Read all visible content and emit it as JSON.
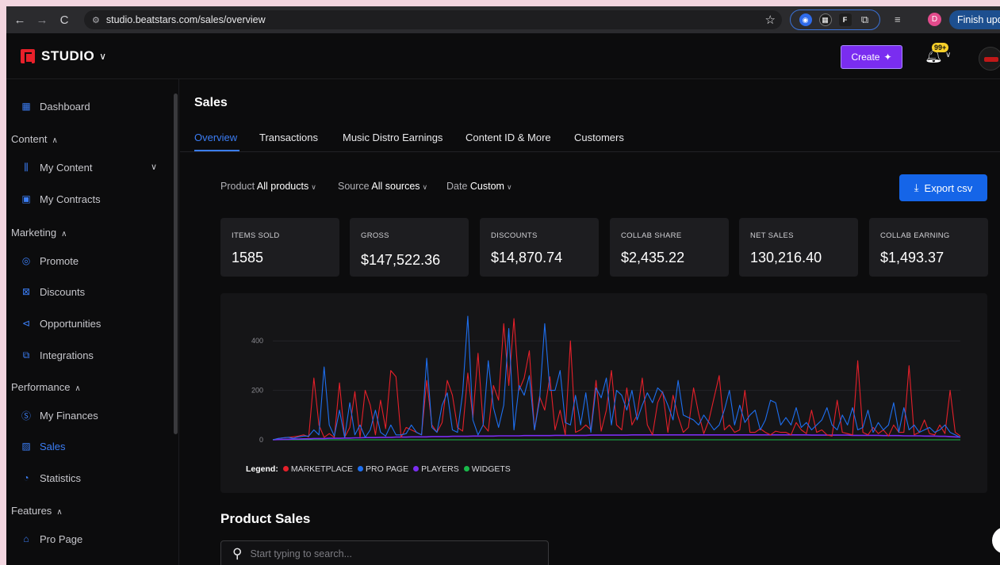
{
  "browser": {
    "url": "studio.beatstars.com/sales/overview",
    "back_icon": "←",
    "forward_icon": "→",
    "reload_icon": "C",
    "profile_initial": "D",
    "finish_label": "Finish upd"
  },
  "header": {
    "brand": "STUDIO",
    "create_label": "Create",
    "notification_badge": "99+"
  },
  "sidebar": {
    "dashboard": "Dashboard",
    "content_head": "Content",
    "my_content": "My Content",
    "my_contracts": "My Contracts",
    "marketing_head": "Marketing",
    "promote": "Promote",
    "discounts": "Discounts",
    "opportunities": "Opportunities",
    "integrations": "Integrations",
    "performance_head": "Performance",
    "my_finances": "My Finances",
    "sales": "Sales",
    "statistics": "Statistics",
    "features_head": "Features",
    "pro_page": "Pro Page",
    "content_id": "Content ID & More"
  },
  "main": {
    "title": "Sales",
    "tabs": [
      "Overview",
      "Transactions",
      "Music Distro Earnings",
      "Content ID & More",
      "Customers"
    ],
    "filters": {
      "product_label": "Product",
      "product_value": "All products",
      "source_label": "Source",
      "source_value": "All sources",
      "date_label": "Date",
      "date_value": "Custom"
    },
    "export_label": "Export csv",
    "cards": [
      {
        "label": "ITEMS SOLD",
        "value": "1585"
      },
      {
        "label": "GROSS",
        "value": "$147,522.36"
      },
      {
        "label": "DISCOUNTS",
        "value": "$14,870.74"
      },
      {
        "label": "COLLAB SHARE",
        "value": "$2,435.22"
      },
      {
        "label": "NET SALES",
        "value": "130,216.40"
      },
      {
        "label": "COLLAB EARNING",
        "value": "$1,493.37"
      }
    ],
    "legend": {
      "title": "Legend:",
      "items": [
        "MARKETPLACE",
        "PRO PAGE",
        "PLAYERS",
        "WIDGETS"
      ]
    },
    "product_sales_title": "Product Sales",
    "search_placeholder": "Start typing to search..."
  },
  "colors": {
    "accent": "#3b7df4",
    "marketplace": "#e5202a",
    "pro_page": "#1e6ff0",
    "players": "#7a2df0",
    "widgets": "#19b94a"
  },
  "chart_data": {
    "type": "line",
    "ylim": [
      0,
      500
    ],
    "yticks": [
      0,
      200,
      400
    ],
    "series": [
      {
        "name": "MARKETPLACE",
        "values": [
          0,
          5,
          8,
          10,
          12,
          15,
          20,
          12,
          250,
          60,
          10,
          25,
          10,
          230,
          10,
          50,
          195,
          10,
          200,
          140,
          20,
          160,
          45,
          280,
          255,
          10,
          50,
          40,
          30,
          20,
          240,
          60,
          30,
          70,
          240,
          180,
          50,
          35,
          270,
          90,
          350,
          60,
          35,
          220,
          160,
          470,
          220,
          490,
          200,
          250,
          360,
          40,
          175,
          120,
          255,
          40,
          120,
          20,
          400,
          30,
          40,
          60,
          40,
          240,
          35,
          120,
          280,
          60,
          40,
          210,
          60,
          100,
          250,
          60,
          20,
          150,
          195,
          30,
          180,
          95,
          30,
          50,
          210,
          105,
          25,
          80,
          170,
          260,
          40,
          60,
          30,
          40,
          200,
          30,
          30,
          45,
          30,
          20,
          35,
          30,
          30,
          20,
          70,
          40,
          25,
          120,
          30,
          40,
          20,
          15,
          160,
          30,
          25,
          20,
          320,
          30,
          20,
          50,
          25,
          40,
          15,
          60,
          30,
          30,
          300,
          20,
          30,
          80,
          25,
          20,
          60,
          25,
          200,
          30,
          15
        ]
      },
      {
        "name": "PRO PAGE",
        "values": [
          0,
          5,
          8,
          10,
          6,
          12,
          15,
          15,
          40,
          20,
          295,
          60,
          15,
          120,
          10,
          150,
          20,
          60,
          10,
          40,
          120,
          30,
          15,
          60,
          20,
          20,
          25,
          60,
          30,
          20,
          330,
          50,
          30,
          140,
          190,
          40,
          30,
          190,
          500,
          80,
          20,
          60,
          320,
          130,
          50,
          140,
          450,
          40,
          220,
          180,
          260,
          40,
          160,
          470,
          200,
          200,
          280,
          70,
          60,
          180,
          60,
          190,
          30,
          210,
          170,
          250,
          60,
          200,
          180,
          120,
          200,
          80,
          140,
          190,
          150,
          210,
          190,
          140,
          80,
          240,
          100,
          90,
          80,
          60,
          100,
          70,
          40,
          60,
          120,
          200,
          60,
          140,
          70,
          100,
          120,
          40,
          80,
          160,
          150,
          60,
          90,
          60,
          130,
          50,
          70,
          40,
          60,
          80,
          130,
          60,
          40,
          100,
          60,
          130,
          40,
          50,
          120,
          30,
          70,
          40,
          60,
          150,
          30,
          130,
          40,
          60,
          30,
          40,
          50,
          30,
          40,
          60,
          30,
          20,
          10
        ]
      },
      {
        "name": "PLAYERS",
        "values": [
          0,
          1,
          2,
          2,
          3,
          3,
          4,
          4,
          5,
          5,
          5,
          6,
          6,
          6,
          7,
          7,
          8,
          8,
          9,
          9,
          9,
          10,
          10,
          10,
          11,
          11,
          11,
          12,
          12,
          12,
          12,
          13,
          13,
          13,
          13,
          14,
          14,
          14,
          14,
          15,
          15,
          15,
          15,
          15,
          16,
          16,
          16,
          16,
          16,
          17,
          17,
          17,
          17,
          17,
          17,
          18,
          18,
          18,
          18,
          18,
          18,
          18,
          19,
          19,
          19,
          19,
          19,
          19,
          19,
          19,
          20,
          20,
          20,
          20,
          20,
          20,
          20,
          20,
          20,
          20,
          20,
          20,
          20,
          20,
          20,
          20,
          20,
          20,
          20,
          20,
          20,
          20,
          20,
          20,
          20,
          20,
          20,
          20,
          20,
          20,
          20,
          20,
          20,
          20,
          20,
          19,
          19,
          19,
          19,
          19,
          19,
          19,
          19,
          18,
          18,
          18,
          18,
          18,
          18,
          17,
          17,
          17,
          17,
          16,
          16,
          16,
          16,
          15,
          15,
          15,
          14,
          14,
          13,
          12,
          11
        ]
      },
      {
        "name": "WIDGETS",
        "values": [
          0,
          0,
          0,
          0,
          0,
          0,
          0,
          0,
          0,
          0,
          0,
          0,
          0,
          0,
          0,
          0,
          0,
          0,
          0,
          0,
          0,
          0,
          0,
          0,
          0,
          0,
          0,
          0,
          0,
          0,
          0,
          0,
          0,
          0,
          0,
          0,
          0,
          0,
          0,
          0,
          0,
          0,
          0,
          0,
          0,
          0,
          0,
          0,
          0,
          0,
          0,
          0,
          0,
          0,
          0,
          0,
          0,
          0,
          0,
          0,
          0,
          0,
          0,
          0,
          0,
          0,
          0,
          0,
          0,
          0,
          0,
          0,
          0,
          0,
          0,
          0,
          0,
          0,
          0,
          0,
          0,
          0,
          0,
          0,
          0,
          0,
          0,
          0,
          0,
          0,
          0,
          0,
          0,
          0,
          0,
          0,
          0,
          0,
          0,
          0,
          0,
          0,
          0,
          0,
          0,
          0,
          0,
          0,
          0,
          0,
          0,
          0,
          0,
          0,
          0,
          0,
          0,
          0,
          0,
          0,
          0,
          0,
          0,
          0,
          0,
          0,
          0,
          0,
          0,
          0,
          0,
          0,
          0,
          0,
          0
        ]
      }
    ]
  }
}
